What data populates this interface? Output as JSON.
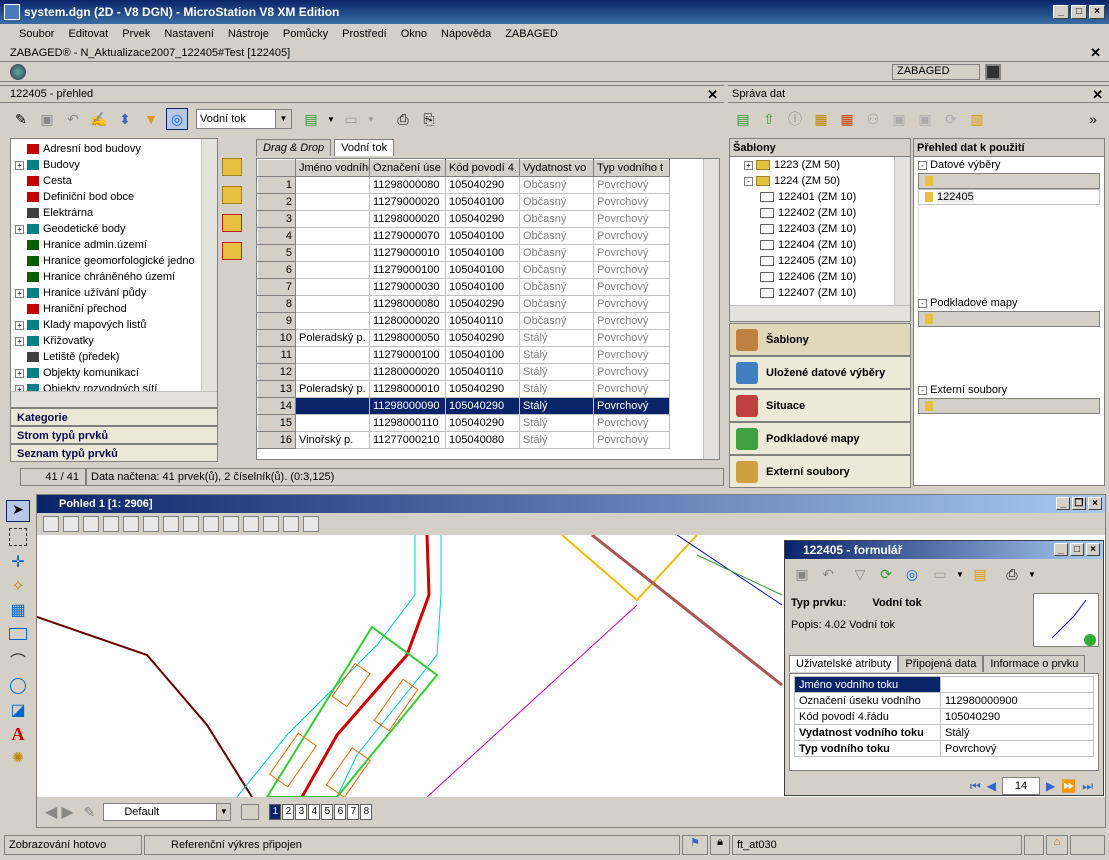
{
  "window": {
    "title": "system.dgn (2D - V8 DGN) - MicroStation V8 XM Edition"
  },
  "menu": [
    "Soubor",
    "Editovat",
    "Prvek",
    "Nastavení",
    "Nástroje",
    "Pomůcky",
    "Prostředí",
    "Okno",
    "Nápověda",
    "ZABAGED"
  ],
  "zabaged_bar": {
    "title": "ZABAGED® - N_Aktualizace2007_122405#Test [122405]",
    "label": "ZABAGED"
  },
  "overview": {
    "title": "122405 - přehled",
    "combo": "Vodní tok"
  },
  "categories": {
    "items": [
      {
        "label": "Adresní bod budovy",
        "exp": false,
        "color": "#c00000"
      },
      {
        "label": "Budovy",
        "exp": true,
        "color": "#008080"
      },
      {
        "label": "Cesta",
        "exp": false,
        "color": "#c00000"
      },
      {
        "label": "Definiční bod obce",
        "exp": false,
        "color": "#c00000"
      },
      {
        "label": "Elektrárna",
        "exp": false,
        "color": "#404040"
      },
      {
        "label": "Geodetické body",
        "exp": true,
        "color": "#008080"
      },
      {
        "label": "Hranice admin.území",
        "exp": false,
        "color": "#006000"
      },
      {
        "label": "Hranice geomorfologické jedno",
        "exp": false,
        "color": "#006000"
      },
      {
        "label": "Hranice chráněného území",
        "exp": false,
        "color": "#006000"
      },
      {
        "label": "Hranice užívání půdy",
        "exp": true,
        "color": "#008080"
      },
      {
        "label": "Hraniční přechod",
        "exp": false,
        "color": "#c00000"
      },
      {
        "label": "Klady mapových listů",
        "exp": true,
        "color": "#008080"
      },
      {
        "label": "Křižovatky",
        "exp": true,
        "color": "#008080"
      },
      {
        "label": "Letiště (předek)",
        "exp": false,
        "color": "#404040"
      },
      {
        "label": "Objekty komunikací",
        "exp": true,
        "color": "#008080"
      },
      {
        "label": "Objekty rozvodných sítí",
        "exp": true,
        "color": "#008080"
      }
    ],
    "buttons": [
      "Kategorie",
      "Strom typů prvků",
      "Seznam typů prvků"
    ]
  },
  "tabs": {
    "drag": "Drag & Drop",
    "vodni": "Vodní tok"
  },
  "table": {
    "headers": [
      "Jméno vodního",
      "Označení úse",
      "Kód povodí 4.",
      "Vydatnost vo",
      "Typ vodního t"
    ],
    "rows": [
      [
        "1",
        "",
        "11298000080",
        "105040290",
        "Občasný",
        "Povrchový"
      ],
      [
        "2",
        "",
        "11279000020",
        "105040100",
        "Občasný",
        "Povrchový"
      ],
      [
        "3",
        "",
        "11298000020",
        "105040290",
        "Občasný",
        "Povrchový"
      ],
      [
        "4",
        "",
        "11279000070",
        "105040100",
        "Občasný",
        "Povrchový"
      ],
      [
        "5",
        "",
        "11279000010",
        "105040100",
        "Občasný",
        "Povrchový"
      ],
      [
        "6",
        "",
        "11279000100",
        "105040100",
        "Občasný",
        "Povrchový"
      ],
      [
        "7",
        "",
        "11279000030",
        "105040100",
        "Občasný",
        "Povrchový"
      ],
      [
        "8",
        "",
        "11298000080",
        "105040290",
        "Občasný",
        "Povrchový"
      ],
      [
        "9",
        "",
        "11280000020",
        "105040110",
        "Občasný",
        "Povrchový"
      ],
      [
        "10",
        "Poleradský p.",
        "11298000050",
        "105040290",
        "Stálý",
        "Povrchový"
      ],
      [
        "11",
        "",
        "11279000100",
        "105040100",
        "Stálý",
        "Povrchový"
      ],
      [
        "12",
        "",
        "11280000020",
        "105040110",
        "Stálý",
        "Povrchový"
      ],
      [
        "13",
        "Poleradský p.",
        "11298000010",
        "105040290",
        "Stálý",
        "Povrchový"
      ],
      [
        "14",
        "",
        "11298000090",
        "105040290",
        "Stálý",
        "Povrchový"
      ],
      [
        "15",
        "",
        "11298000110",
        "105040290",
        "Stálý",
        "Povrchový"
      ],
      [
        "16",
        "Vinořský p.",
        "11277000210",
        "105040080",
        "Stálý",
        "Povrchový"
      ]
    ],
    "selected": 13
  },
  "status": {
    "count": "41 / 41",
    "message": "Data načtena: 41 prvek(ů), 2 číselník(ů). (0:3,125)"
  },
  "sprava": {
    "title": "Správa dat",
    "sablony": "Šablony",
    "tree": [
      {
        "label": "1223 (ZM 50)",
        "level": 0,
        "exp": "+"
      },
      {
        "label": "1224 (ZM 50)",
        "level": 0,
        "exp": "-"
      },
      {
        "label": "122401 (ZM 10)",
        "level": 1
      },
      {
        "label": "122402 (ZM 10)",
        "level": 1
      },
      {
        "label": "122403 (ZM 10)",
        "level": 1
      },
      {
        "label": "122404 (ZM 10)",
        "level": 1
      },
      {
        "label": "122405 (ZM 10)",
        "level": 1
      },
      {
        "label": "122406 (ZM 10)",
        "level": 1
      },
      {
        "label": "122407 (ZM 10)",
        "level": 1
      }
    ],
    "buttons": [
      {
        "label": "Šablony",
        "color": "#c08040"
      },
      {
        "label": "Uložené datové výběry",
        "color": "#4080c0"
      },
      {
        "label": "Situace",
        "color": "#c04040"
      },
      {
        "label": "Podkladové mapy",
        "color": "#40a040"
      },
      {
        "label": "Externí soubory",
        "color": "#d0a040"
      }
    ]
  },
  "prehled": {
    "title": "Přehled dat k použití",
    "datove": "Datové výběry",
    "datove_item": "122405",
    "podkladove": "Podkladové mapy",
    "externi": "Externí soubory"
  },
  "view": {
    "title": "Pohled 1 [1: 2906]",
    "level": "Default",
    "views": [
      "1",
      "2",
      "3",
      "4",
      "5",
      "6",
      "7",
      "8"
    ]
  },
  "form": {
    "title": "122405 - formulář",
    "typ_label": "Typ prvku:",
    "typ_value": "Vodní tok",
    "popis": "Popis:  4.02 Vodní tok",
    "tabs": [
      "Uživatelské atributy",
      "Připojená data",
      "Informace o prvku"
    ],
    "attrs": [
      {
        "name": "Jméno vodního toku",
        "value": "",
        "sel": true,
        "bold": false
      },
      {
        "name": "Označení úseku vodního",
        "value": "112980000900",
        "sel": false,
        "bold": false
      },
      {
        "name": "Kód povodí 4.řádu",
        "value": "105040290",
        "sel": false,
        "bold": false
      },
      {
        "name": "Vydatnost vodního toku",
        "value": "Stálý",
        "sel": false,
        "bold": true
      },
      {
        "name": "Typ vodního toku",
        "value": "Povrchový",
        "sel": false,
        "bold": true
      }
    ],
    "page": "14"
  },
  "bottom_status": {
    "left": "Zobrazování hotovo",
    "mid": "Referenční výkres připojen",
    "right": "ft_at030"
  }
}
